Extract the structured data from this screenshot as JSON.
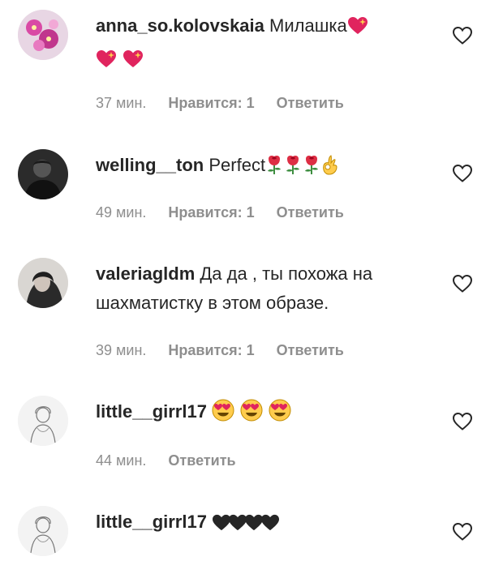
{
  "comments": [
    {
      "username": "anna_so.kolovskaia",
      "text": "Милашка",
      "emoji": [
        "sparkle-heart",
        "sparkle-heart",
        "sparkle-heart"
      ],
      "time": "37 мин.",
      "likes": "Нравится: 1",
      "reply": "Ответить"
    },
    {
      "username": "welling__ton",
      "text": "Perfect",
      "emoji": [
        "rose",
        "rose",
        "rose",
        "ok-hand"
      ],
      "time": "49 мин.",
      "likes": "Нравится: 1",
      "reply": "Ответить"
    },
    {
      "username": "valeriagldm",
      "text": "Да да , ты похожа на шахматистку в этом образе.",
      "emoji": [],
      "time": "39 мин.",
      "likes": "Нравится: 1",
      "reply": "Ответить"
    },
    {
      "username": "little__girrl17",
      "text": "",
      "emoji": [
        "heart-eyes",
        "heart-eyes",
        "heart-eyes"
      ],
      "time": "44 мин.",
      "likes": "",
      "reply": "Ответить"
    },
    {
      "username": "little__girrl17",
      "text": "",
      "emoji": [
        "black-heart",
        "black-heart",
        "black-heart",
        "black-heart"
      ],
      "time": "",
      "likes": "",
      "reply": ""
    }
  ],
  "colors": {
    "text": "#262626",
    "secondary": "#8e8e8e",
    "heart_outline": "#262626",
    "emoji_red": "#e0245e",
    "emoji_yellow": "#ffcc4d",
    "rose_green": "#3e8e41"
  }
}
